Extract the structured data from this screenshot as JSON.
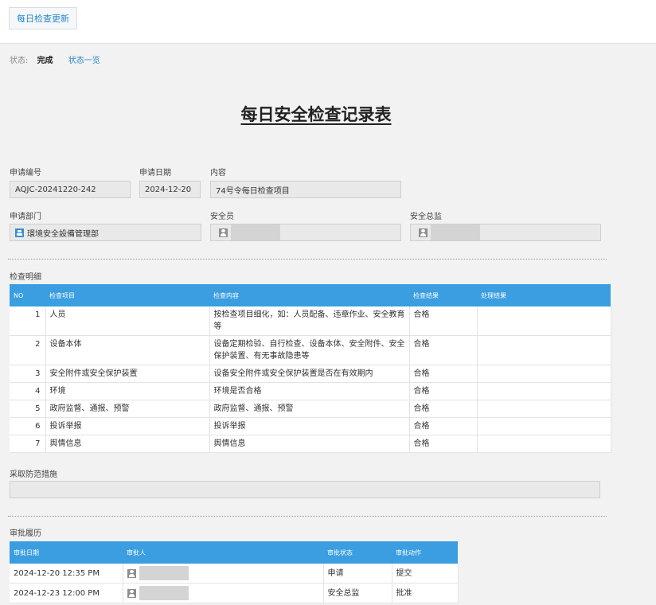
{
  "toolbar": {
    "update_label": "每日检查更新"
  },
  "status": {
    "label": "状态:",
    "value": "完成",
    "link": "状态一览"
  },
  "form": {
    "title": "每日安全检查记录表",
    "app_no_label": "申请编号",
    "app_no": "AQJC-20241220-242",
    "app_date_label": "申请日期",
    "app_date": "2024-12-20",
    "content_label": "内容",
    "content": "74号令每日检查项目",
    "dept_label": "申请部门",
    "dept": "環境安全設備管理部",
    "officer_label": "安全员",
    "director_label": "安全总监"
  },
  "details": {
    "section_label": "检查明细",
    "headers": [
      "NO",
      "检查项目",
      "检查内容",
      "检查结果",
      "处理结果"
    ],
    "rows": [
      {
        "no": "1",
        "item": "人员",
        "content": "按检查项目细化，如：人员配备、违章作业、安全教育等",
        "result": "合格",
        "handling": ""
      },
      {
        "no": "2",
        "item": "设备本体",
        "content": "设备定期检验、自行检查、设备本体、安全附件、安全保护装置、有无事故隐患等",
        "result": "合格",
        "handling": ""
      },
      {
        "no": "3",
        "item": "安全附件或安全保护装置",
        "content": "设备安全附件或安全保护装置是否在有效期内",
        "result": "合格",
        "handling": ""
      },
      {
        "no": "4",
        "item": "环境",
        "content": "环境是否合格",
        "result": "合格",
        "handling": ""
      },
      {
        "no": "5",
        "item": "政府监督、通报、预警",
        "content": "政府监督、通报、预警",
        "result": "合格",
        "handling": ""
      },
      {
        "no": "6",
        "item": "投诉举报",
        "content": "投诉举报",
        "result": "合格",
        "handling": ""
      },
      {
        "no": "7",
        "item": "舆情信息",
        "content": "舆情信息",
        "result": "合格",
        "handling": ""
      }
    ]
  },
  "measures": {
    "label": "采取防范措施"
  },
  "history": {
    "section_label": "审批履历",
    "headers": [
      "审批日期",
      "审批人",
      "审批状态",
      "审批动作"
    ],
    "rows": [
      {
        "date": "2024-12-20 12:35 PM",
        "status": "申请",
        "action": "提交"
      },
      {
        "date": "2024-12-23 12:00 PM",
        "status": "安全总监",
        "action": "批准"
      }
    ]
  }
}
